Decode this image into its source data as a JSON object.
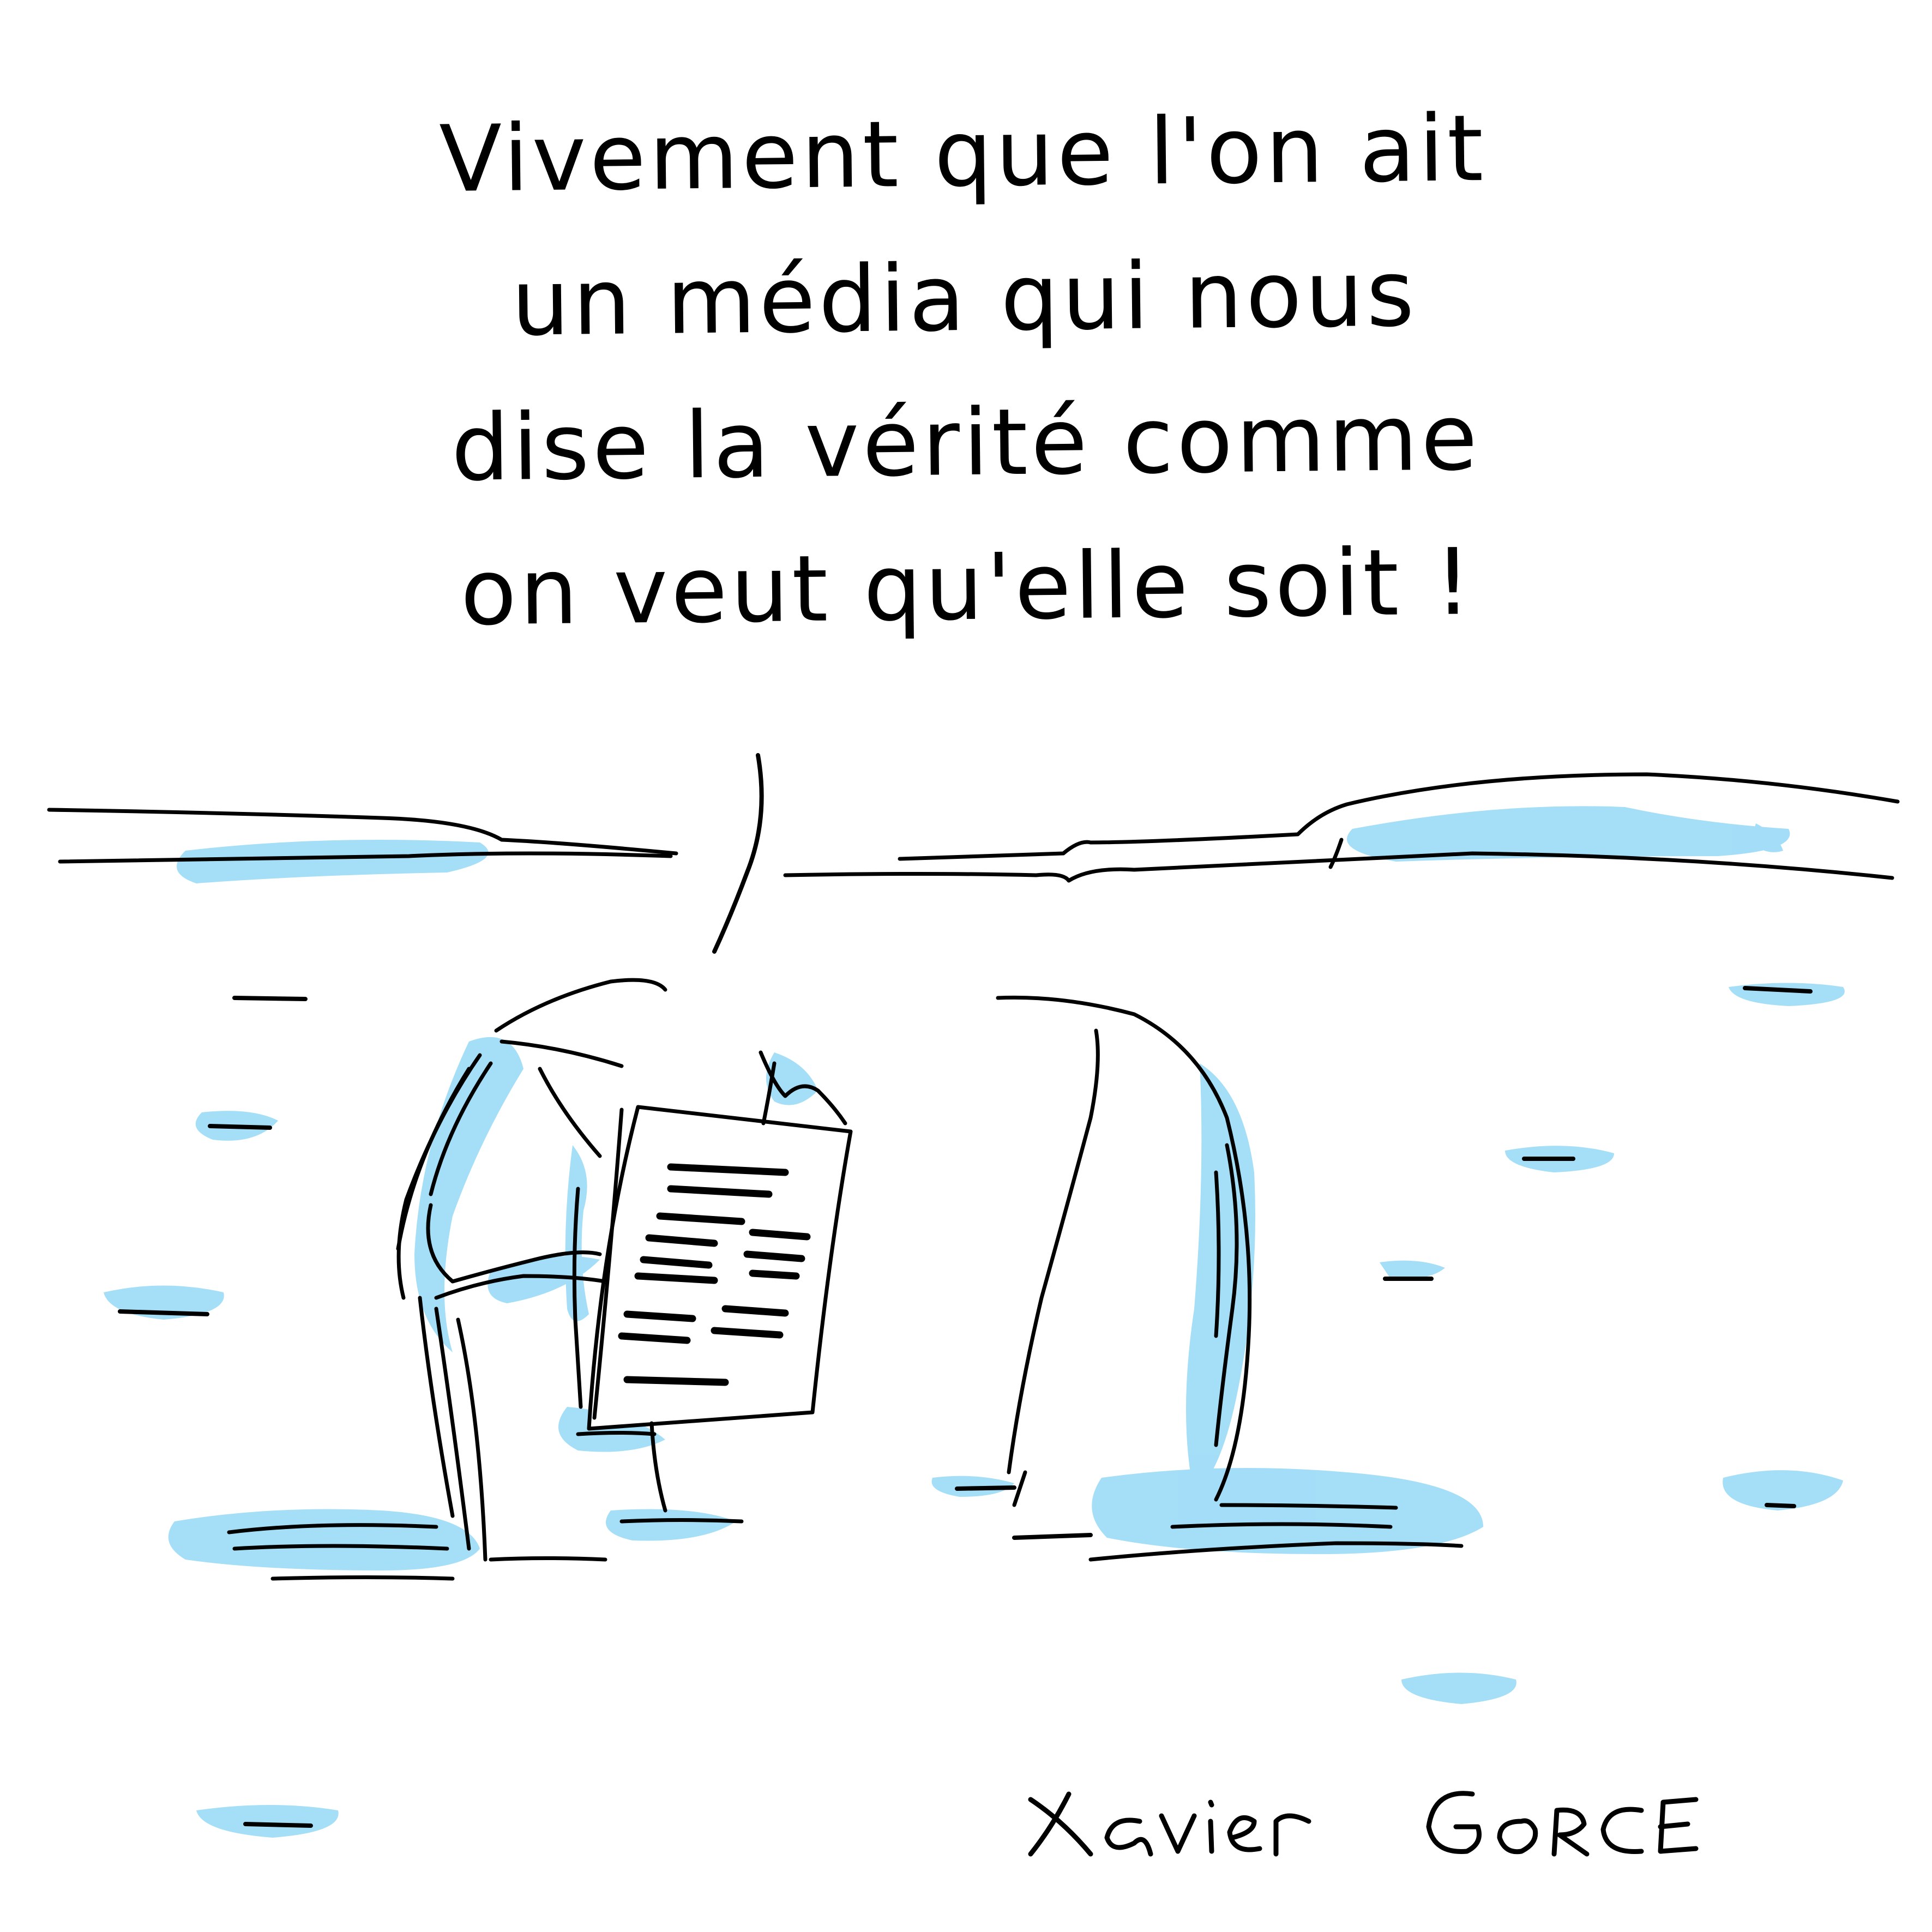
{
  "cartoon": {
    "speech": [
      "Vivement que l'on ait",
      "un média qui nous",
      "dise la vérité comme",
      "on veut qu'elle soit !"
    ],
    "signature": "Xavier GORCE"
  },
  "colors": {
    "ink": "#000000",
    "accent": "#9fdcf7",
    "background": "#ffffff"
  },
  "icons": {
    "left_character": "penguin-reading-newspaper-icon",
    "right_character": "penguin-icon",
    "newspaper": "newspaper-icon"
  }
}
